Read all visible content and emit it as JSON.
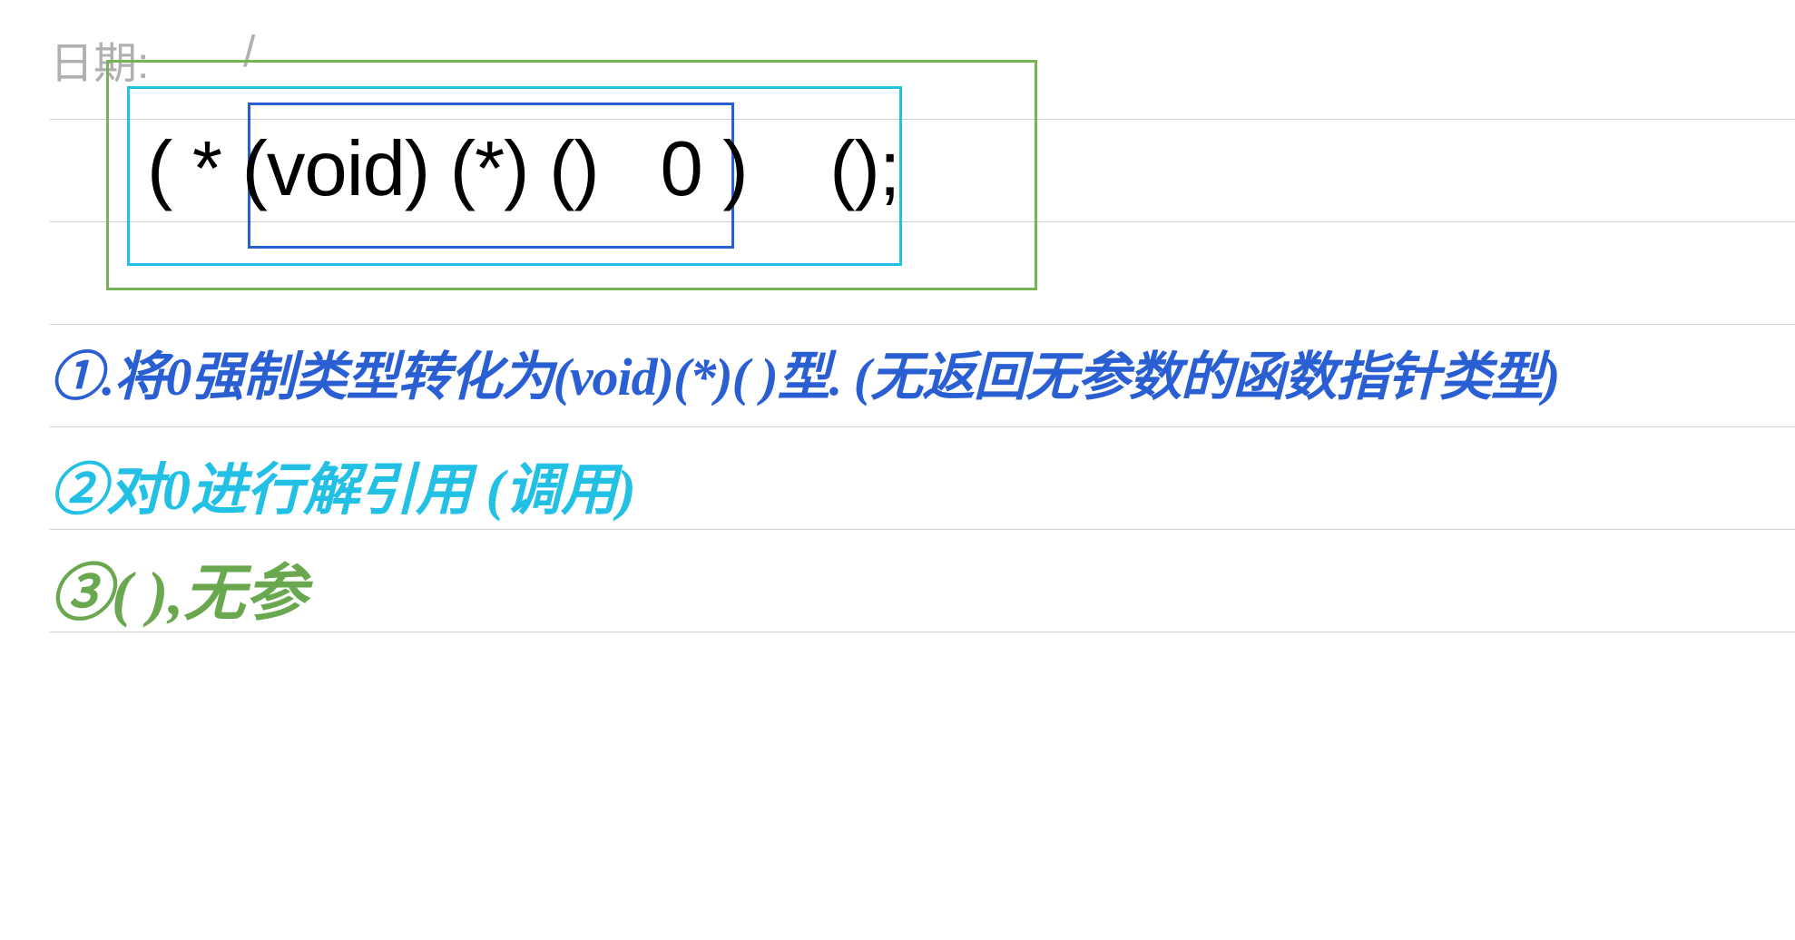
{
  "header": {
    "date_label": "日期:",
    "date_slash": "/"
  },
  "code": {
    "expression": "( * (void) (*) ()   0 )    ();"
  },
  "annotations": [
    {
      "color": "blue",
      "text": "①.将0强制类型转化为(void)(*)( )型. (无返回无参数的函数指针类型)"
    },
    {
      "color": "cyan",
      "text": "②对0进行解引用 (调用)"
    },
    {
      "color": "green",
      "text": "③( ),无参"
    }
  ],
  "boxes": {
    "outer": "green",
    "middle": "cyan",
    "inner": "blue"
  }
}
